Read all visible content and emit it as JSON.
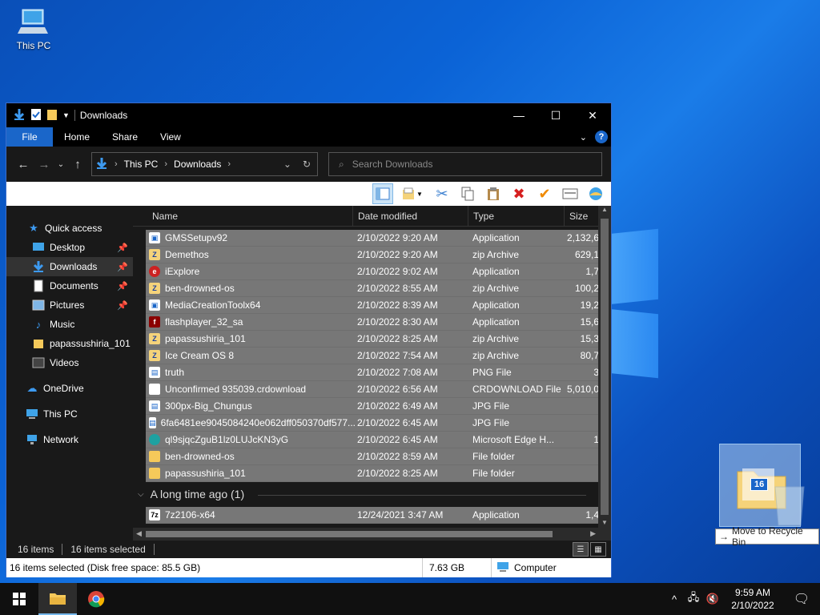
{
  "desktop": {
    "icons": [
      {
        "label": "This PC"
      }
    ]
  },
  "window": {
    "title": "Downloads",
    "ribbon_tabs": [
      "File",
      "Home",
      "Share",
      "View"
    ],
    "address": {
      "root": "This PC",
      "folder": "Downloads"
    },
    "search_placeholder": "Search Downloads",
    "sidebar": [
      {
        "label": "Quick access",
        "icon": "star-icon"
      },
      {
        "label": "Desktop",
        "icon": "desktop-icon",
        "pinned": true
      },
      {
        "label": "Downloads",
        "icon": "download-icon",
        "pinned": true,
        "active": true
      },
      {
        "label": "Documents",
        "icon": "documents-icon",
        "pinned": true
      },
      {
        "label": "Pictures",
        "icon": "pictures-icon",
        "pinned": true
      },
      {
        "label": "Music",
        "icon": "music-icon"
      },
      {
        "label": "papassushiria_101",
        "icon": "folder-icon"
      },
      {
        "label": "Videos",
        "icon": "videos-icon"
      },
      {
        "label": "OneDrive",
        "icon": "cloud-icon"
      },
      {
        "label": "This PC",
        "icon": "computer-icon"
      },
      {
        "label": "Network",
        "icon": "network-icon"
      }
    ],
    "columns": [
      "Name",
      "Date modified",
      "Type",
      "Size"
    ],
    "files": [
      {
        "name": "GMSSetupv92",
        "date": "2/10/2022 9:20 AM",
        "type": "Application",
        "size": "2,132,6",
        "icon": "app"
      },
      {
        "name": "Demethos",
        "date": "2/10/2022 9:20 AM",
        "type": "zip Archive",
        "size": "629,1",
        "icon": "zip"
      },
      {
        "name": "iExplore",
        "date": "2/10/2022 9:02 AM",
        "type": "Application",
        "size": "1,7",
        "icon": "ie"
      },
      {
        "name": "ben-drowned-os",
        "date": "2/10/2022 8:55 AM",
        "type": "zip Archive",
        "size": "100,2",
        "icon": "zip"
      },
      {
        "name": "MediaCreationToolx64",
        "date": "2/10/2022 8:39 AM",
        "type": "Application",
        "size": "19,2",
        "icon": "app"
      },
      {
        "name": "flashplayer_32_sa",
        "date": "2/10/2022 8:30 AM",
        "type": "Application",
        "size": "15,6",
        "icon": "flash"
      },
      {
        "name": "papassushiria_101",
        "date": "2/10/2022 8:25 AM",
        "type": "zip Archive",
        "size": "15,3",
        "icon": "zip"
      },
      {
        "name": "Ice Cream OS 8",
        "date": "2/10/2022 7:54 AM",
        "type": "zip Archive",
        "size": "80,7",
        "icon": "zip"
      },
      {
        "name": "truth",
        "date": "2/10/2022 7:08 AM",
        "type": "PNG File",
        "size": "3",
        "icon": "img"
      },
      {
        "name": "Unconfirmed 935039.crdownload",
        "date": "2/10/2022 6:56 AM",
        "type": "CRDOWNLOAD File",
        "size": "5,010,0",
        "icon": "blank"
      },
      {
        "name": "300px-Big_Chungus",
        "date": "2/10/2022 6:49 AM",
        "type": "JPG File",
        "size": "",
        "icon": "img"
      },
      {
        "name": "6fa6481ee9045084240e062dff050370df577...",
        "date": "2/10/2022 6:45 AM",
        "type": "JPG File",
        "size": "",
        "icon": "img"
      },
      {
        "name": "ql9sjqcZguB1lz0LUJcKN3yG",
        "date": "2/10/2022 6:45 AM",
        "type": "Microsoft Edge H...",
        "size": "1",
        "icon": "edge"
      },
      {
        "name": "ben-drowned-os",
        "date": "2/10/2022 8:59 AM",
        "type": "File folder",
        "size": "",
        "icon": "folder"
      },
      {
        "name": "papassushiria_101",
        "date": "2/10/2022 8:25 AM",
        "type": "File folder",
        "size": "",
        "icon": "folder"
      }
    ],
    "group_label": "A long time ago (1)",
    "old_files": [
      {
        "name": "7z2106-x64",
        "date": "12/24/2021 3:47 AM",
        "type": "Application",
        "size": "1,4",
        "icon": "7z"
      }
    ],
    "status": {
      "items": "16 items",
      "selected": "16 items selected"
    },
    "classic_status": {
      "main": "16 items selected (Disk free space: 85.5 GB)",
      "size": "7.63 GB",
      "location": "Computer"
    }
  },
  "drag": {
    "count": "16",
    "tooltip": "Move to Recycle Bin",
    "target_label": "Recycle Bin"
  },
  "taskbar": {
    "time": "9:59 AM",
    "date": "2/10/2022"
  }
}
